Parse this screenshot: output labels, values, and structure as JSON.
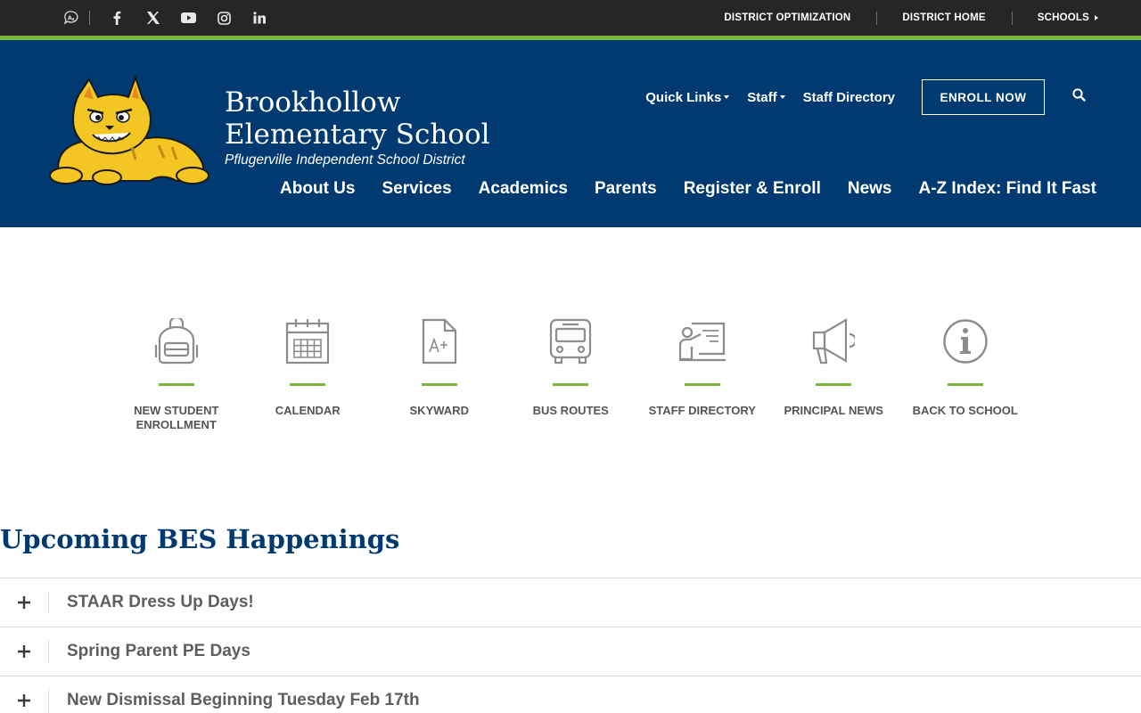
{
  "topbar": {
    "social_icons": [
      "translate-icon",
      "facebook-icon",
      "x-icon",
      "youtube-icon",
      "instagram-icon",
      "linkedin-icon"
    ],
    "links": [
      {
        "label": "DISTRICT OPTIMIZATION"
      },
      {
        "label": "DISTRICT HOME"
      },
      {
        "label": "SCHOOLS"
      }
    ]
  },
  "header": {
    "school_name": "Brookhollow Elementary School",
    "district_name": "Pflugerville Independent School District",
    "util_nav": {
      "quick_links": "Quick Links",
      "staff": "Staff",
      "staff_directory": "Staff Directory",
      "enroll": "ENROLL NOW"
    },
    "main_nav": [
      "About Us",
      "Services",
      "Academics",
      "Parents",
      "Register & Enroll",
      "News",
      "A-Z Index: Find It Fast"
    ]
  },
  "quick_links": [
    {
      "label": "NEW STUDENT ENROLLMENT",
      "icon": "backpack-icon"
    },
    {
      "label": "CALENDAR",
      "icon": "calendar-icon"
    },
    {
      "label": "SKYWARD",
      "icon": "grade-document-icon"
    },
    {
      "label": "BUS ROUTES",
      "icon": "bus-icon"
    },
    {
      "label": "STAFF DIRECTORY",
      "icon": "teacher-board-icon"
    },
    {
      "label": "PRINCIPAL NEWS",
      "icon": "megaphone-icon"
    },
    {
      "label": "BACK TO SCHOOL",
      "icon": "info-icon"
    }
  ],
  "happenings": {
    "title": "Upcoming BES Happenings",
    "items": [
      {
        "title": "STAAR Dress Up Days!"
      },
      {
        "title": "Spring Parent PE Days"
      },
      {
        "title": "New Dismissal Beginning Tuesday Feb 17th"
      }
    ]
  },
  "colors": {
    "topbar": "#262626",
    "accent_green": "#79b93a",
    "header_blue": "#003a70",
    "icon_gray": "#8c8c8c",
    "text_gray": "#555555"
  }
}
